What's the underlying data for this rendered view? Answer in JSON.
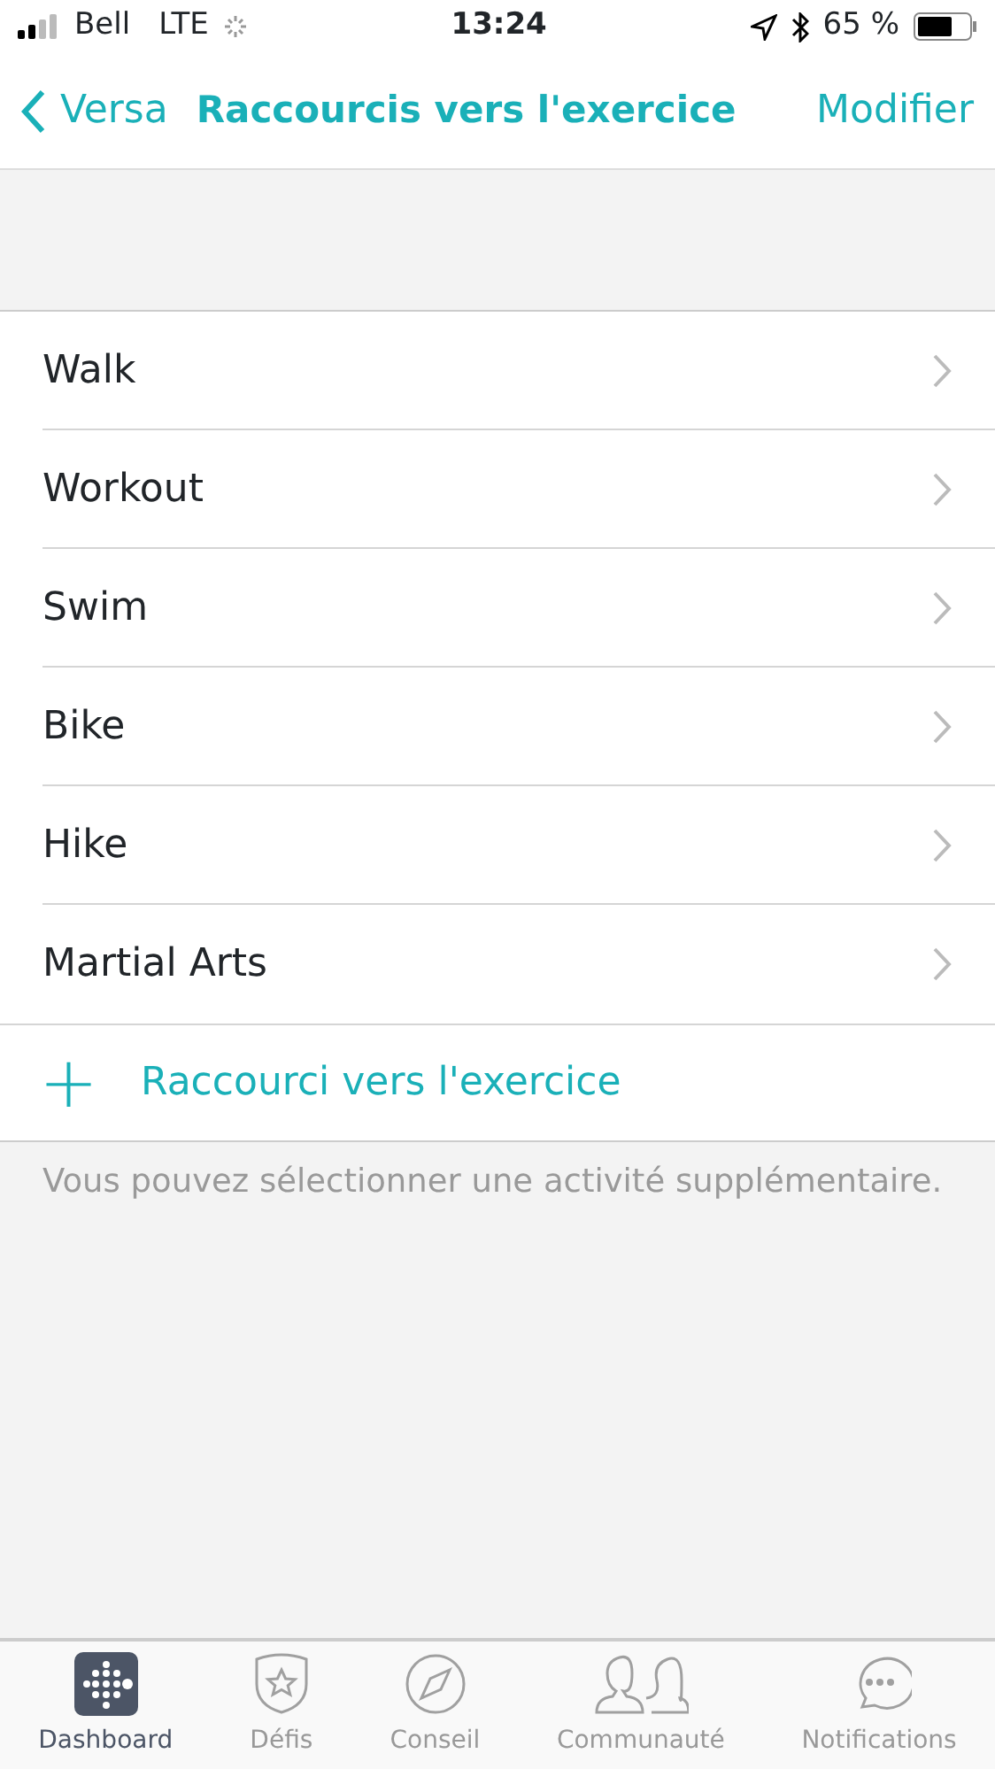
{
  "status_bar": {
    "carrier": "Bell",
    "network": "LTE",
    "time": "13:24",
    "battery": "65 %"
  },
  "nav": {
    "back": "Versa",
    "title": "Raccourcis vers l'exercice",
    "action": "Modifier"
  },
  "items": [
    {
      "label": "Walk"
    },
    {
      "label": "Workout"
    },
    {
      "label": "Swim"
    },
    {
      "label": "Bike"
    },
    {
      "label": "Hike"
    },
    {
      "label": "Martial Arts"
    }
  ],
  "add": {
    "icon": "+",
    "label": "Raccourci vers l'exercice"
  },
  "note": "Vous pouvez sélectionner une activité supplémentaire.",
  "tabs": [
    {
      "label": "Dashboard",
      "kind": "dashboard",
      "selected": true
    },
    {
      "label": "Défis",
      "kind": "badge",
      "selected": false
    },
    {
      "label": "Conseil",
      "kind": "compass",
      "selected": false
    },
    {
      "label": "Communauté",
      "kind": "people",
      "selected": false
    },
    {
      "label": "Notifications",
      "kind": "chat",
      "selected": false
    }
  ]
}
